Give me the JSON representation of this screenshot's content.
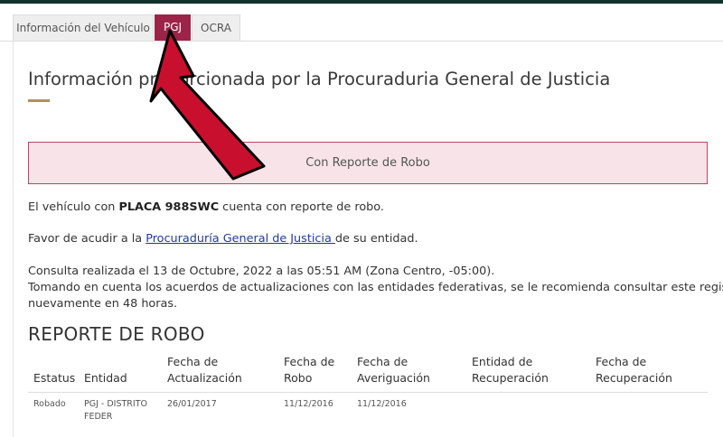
{
  "tabs": [
    {
      "label": "Información del Vehículo"
    },
    {
      "label": "PGJ"
    },
    {
      "label": "OCRA"
    }
  ],
  "heading": "Información proporcionada por la Procuraduria General de Justicia",
  "alert_text": "Con Reporte de Robo",
  "message": {
    "prefix": "El vehículo con ",
    "plate": "PLACA 988SWC",
    "suffix": " cuenta con reporte de robo."
  },
  "advice": {
    "prefix": "Favor de acudir a la ",
    "link": "Procuraduría General de Justicia ",
    "suffix": "de su entidad."
  },
  "consult": {
    "line1": "Consulta realizada el 13 de Octubre, 2022 a las 05:51 AM (Zona Centro, -05:00).",
    "line2": "Tomando en cuenta los acuerdos de actualizaciones con las entidades federativas, se le recomienda consultar este registro",
    "line3": "nuevamente en 48 horas."
  },
  "report_title": "REPORTE DE ROBO",
  "table": {
    "headers": [
      [
        "",
        "Estatus"
      ],
      [
        "",
        "Entidad"
      ],
      [
        "Fecha de",
        "Actualización"
      ],
      [
        "Fecha de",
        "Robo"
      ],
      [
        "Fecha de",
        "Averiguación"
      ],
      [
        "Entidad de",
        "Recuperación"
      ],
      [
        "Fecha de",
        "Recuperación"
      ]
    ],
    "row": [
      "Robado",
      "PGJ - DISTRITO",
      "FEDER",
      "26/01/2017",
      "11/12/2016",
      "11/12/2016"
    ]
  },
  "colors": {
    "accent": "#9d2449",
    "arrow": "#c8102e",
    "alert_border": "#c0445e",
    "alert_bg": "#f8e4e8",
    "gold": "#b38e5d"
  }
}
